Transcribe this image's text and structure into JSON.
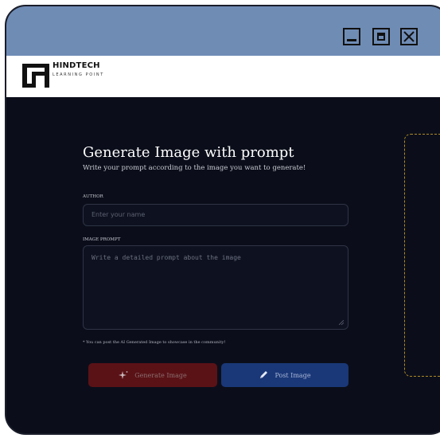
{
  "brand": {
    "name": "HINDTECH",
    "tagline": "LEARNING POINT"
  },
  "page": {
    "title": "Generate Image with prompt",
    "subtitle": "Write your prompt according to the image you want to generate!"
  },
  "form": {
    "author_label": "AUTHOR",
    "author_placeholder": "Enter your name",
    "prompt_label": "IMAGE PROMPT",
    "prompt_placeholder": "Write a detailed prompt about the image",
    "note": "* You can post the AI Generated Image to showcase in the community!"
  },
  "buttons": {
    "generate_label": "Generate Image",
    "post_label": "Post Image"
  },
  "colors": {
    "background": "#0b0e1a",
    "titlebar": "#6f8cb5",
    "generate_button": "#5a1216",
    "post_button": "#1a3878",
    "preview_border": "#b08a25"
  },
  "icons": {
    "generate": "sparkle-icon",
    "post": "pencil-icon",
    "window_controls": [
      "minimize-icon",
      "maximize-icon",
      "close-icon"
    ]
  }
}
